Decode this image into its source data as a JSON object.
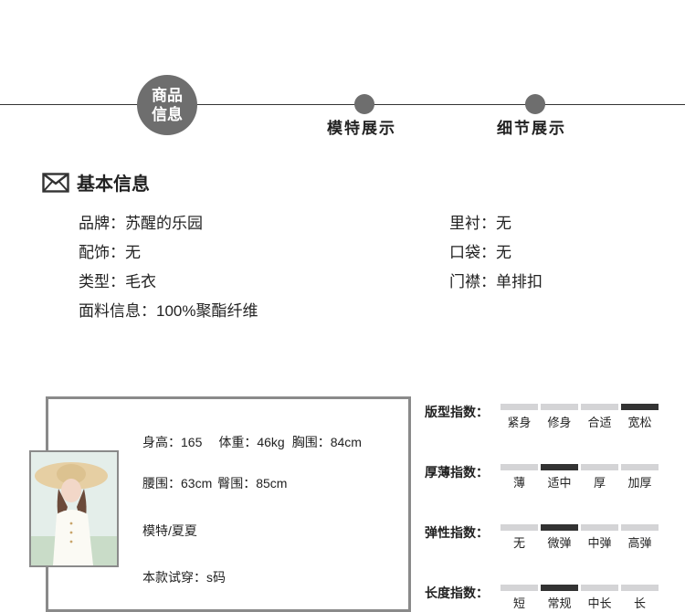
{
  "timeline": {
    "active": {
      "line1": "商品",
      "line2": "信息"
    },
    "steps": [
      "模特展示",
      "细节展示"
    ]
  },
  "basic_info": {
    "title": "基本信息",
    "icon": "mail-icon",
    "left": [
      {
        "key": "品牌",
        "value": "苏醒的乐园"
      },
      {
        "key": "配饰",
        "value": "无"
      },
      {
        "key": "类型",
        "value": "毛衣"
      },
      {
        "key": "面料信息",
        "value": "100%聚酯纤维"
      }
    ],
    "right": [
      {
        "key": "里衬",
        "value": "无"
      },
      {
        "key": "口袋",
        "value": "无"
      },
      {
        "key": "门襟",
        "value": "单排扣"
      }
    ]
  },
  "model": {
    "height": "身高：165",
    "weight": "体重：46kg",
    "chest": "胸围：84cm",
    "waist": "腰围：63cm",
    "hip": "臀围：85cm",
    "name": "模特/夏夏",
    "size_tried": "本款试穿：s码"
  },
  "scales": [
    {
      "label": "版型指数：",
      "options": [
        "紧身",
        "修身",
        "合适",
        "宽松"
      ],
      "selected": 3
    },
    {
      "label": "厚薄指数：",
      "options": [
        "薄",
        "适中",
        "厚",
        "加厚"
      ],
      "selected": 1
    },
    {
      "label": "弹性指数：",
      "options": [
        "无",
        "微弹",
        "中弹",
        "高弹"
      ],
      "selected": 1
    },
    {
      "label": "长度指数：",
      "options": [
        "短",
        "常规",
        "中长",
        "长"
      ],
      "selected": 1
    }
  ],
  "colors": {
    "active_bar": "#333333",
    "inactive_bar": "#d4d4d6",
    "circle": "#6e6e6e",
    "border": "#8a8a8a"
  }
}
